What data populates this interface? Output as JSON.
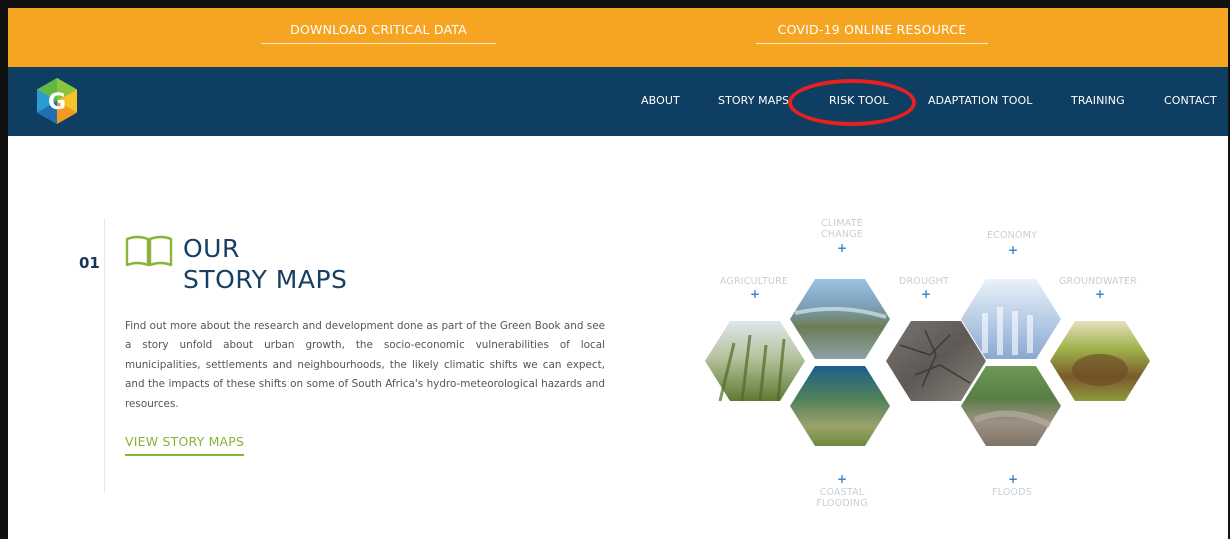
{
  "top_links": {
    "download": "DOWNLOAD CRITICAL DATA",
    "covid": "COVID-19 ONLINE RESOURCE"
  },
  "nav": {
    "logo_letter": "G",
    "items": [
      "ABOUT",
      "STORY MAPS",
      "RISK TOOL",
      "ADAPTATION TOOL",
      "TRAINING",
      "CONTACT"
    ]
  },
  "section": {
    "number": "01",
    "title_line1": "OUR",
    "title_line2": "STORY MAPS",
    "description": "Find out more about the research and development done as part of the Green Book and see a story unfold about urban growth, the socio-economic vulnerabilities of local municipalities, settlements and neighbourhoods, the likely climatic shifts we can expect, and the impacts of these shifts on some of South Africa's hydro-meteorological hazards and resources.",
    "cta": "VIEW STORY MAPS"
  },
  "hex_labels": {
    "climate_change_1": "CLIMATE",
    "climate_change_2": "CHANGE",
    "economy": "ECONOMY",
    "agriculture": "AGRICULTURE",
    "drought": "DROUGHT",
    "groundwater": "GROUNDWATER",
    "coastal_1": "COASTAL",
    "coastal_2": "FLOODING",
    "floods": "FLOODS"
  },
  "colors": {
    "top_bar": "#f6a523",
    "nav_bar": "#0f3e63",
    "accent_green": "#8ab33a",
    "highlight_circle": "#e8201f"
  }
}
